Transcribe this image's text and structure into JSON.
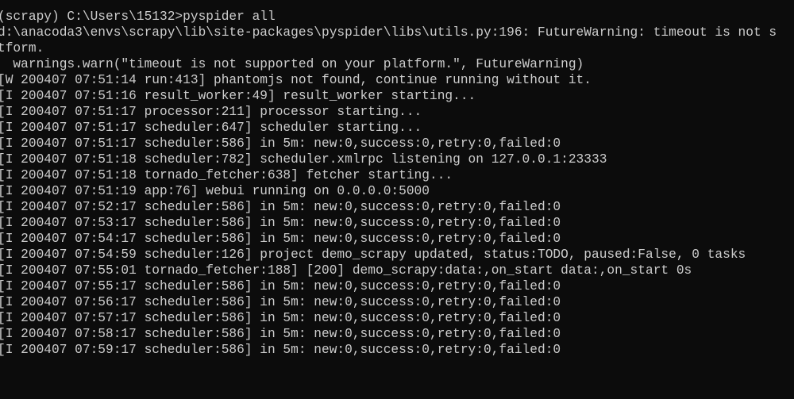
{
  "theme": {
    "background": "#0c0c0c",
    "foreground": "#cccccc"
  },
  "lines": [
    "(scrapy) C:\\Users\\15132>pyspider all",
    "d:\\anacoda3\\envs\\scrapy\\lib\\site-packages\\pyspider\\libs\\utils.py:196: FutureWarning: timeout is not s",
    "tform.",
    "  warnings.warn(\"timeout is not supported on your platform.\", FutureWarning)",
    "[W 200407 07:51:14 run:413] phantomjs not found, continue running without it.",
    "[I 200407 07:51:16 result_worker:49] result_worker starting...",
    "[I 200407 07:51:17 processor:211] processor starting...",
    "[I 200407 07:51:17 scheduler:647] scheduler starting...",
    "[I 200407 07:51:17 scheduler:586] in 5m: new:0,success:0,retry:0,failed:0",
    "[I 200407 07:51:18 scheduler:782] scheduler.xmlrpc listening on 127.0.0.1:23333",
    "[I 200407 07:51:18 tornado_fetcher:638] fetcher starting...",
    "[I 200407 07:51:19 app:76] webui running on 0.0.0.0:5000",
    "[I 200407 07:52:17 scheduler:586] in 5m: new:0,success:0,retry:0,failed:0",
    "[I 200407 07:53:17 scheduler:586] in 5m: new:0,success:0,retry:0,failed:0",
    "[I 200407 07:54:17 scheduler:586] in 5m: new:0,success:0,retry:0,failed:0",
    "[I 200407 07:54:59 scheduler:126] project demo_scrapy updated, status:TODO, paused:False, 0 tasks",
    "[I 200407 07:55:01 tornado_fetcher:188] [200] demo_scrapy:data:,on_start data:,on_start 0s",
    "[I 200407 07:55:17 scheduler:586] in 5m: new:0,success:0,retry:0,failed:0",
    "[I 200407 07:56:17 scheduler:586] in 5m: new:0,success:0,retry:0,failed:0",
    "[I 200407 07:57:17 scheduler:586] in 5m: new:0,success:0,retry:0,failed:0",
    "[I 200407 07:58:17 scheduler:586] in 5m: new:0,success:0,retry:0,failed:0",
    "[I 200407 07:59:17 scheduler:586] in 5m: new:0,success:0,retry:0,failed:0"
  ]
}
